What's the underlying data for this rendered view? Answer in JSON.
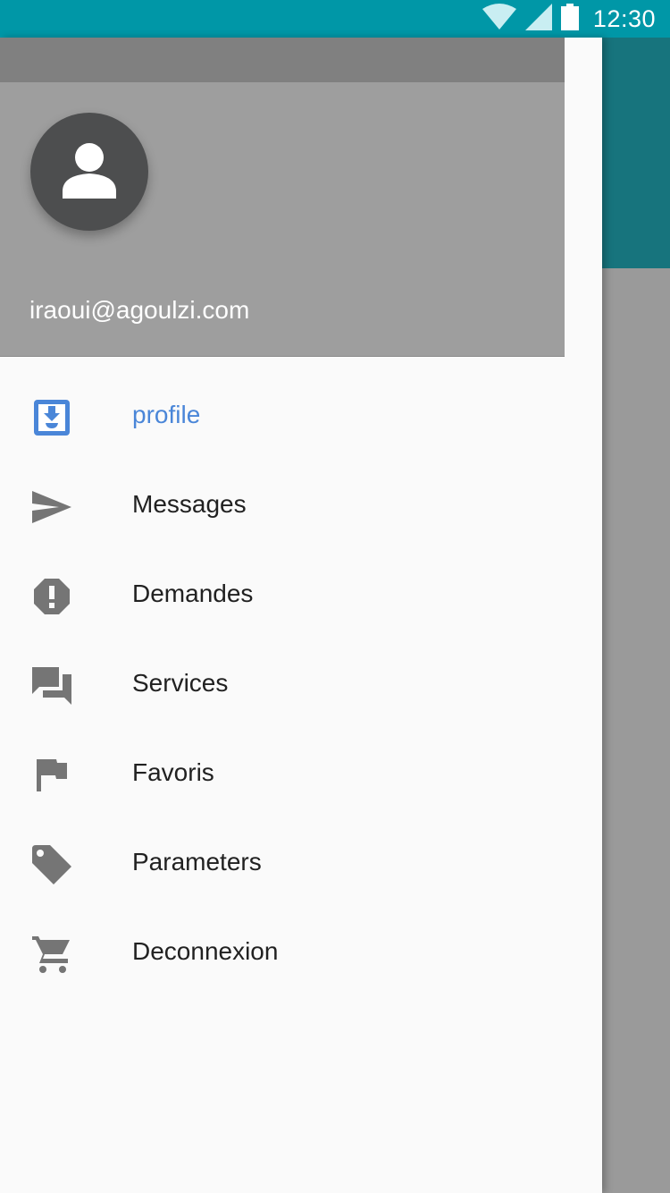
{
  "status_bar": {
    "time": "12:30",
    "icons": [
      "wifi-icon",
      "cell-signal-icon",
      "battery-icon"
    ],
    "background": "#0097a7"
  },
  "drawer": {
    "header": {
      "avatar_icon": "person-icon",
      "email": "iraoui@agoulzi.com"
    },
    "menu": [
      {
        "label": "profile",
        "icon": "move-to-inbox-icon",
        "active": true
      },
      {
        "label": "Messages",
        "icon": "send-icon",
        "active": false
      },
      {
        "label": "Demandes",
        "icon": "report-icon",
        "active": false
      },
      {
        "label": "Services",
        "icon": "forum-icon",
        "active": false
      },
      {
        "label": "Favoris",
        "icon": "flag-icon",
        "active": false
      },
      {
        "label": "Parameters",
        "icon": "label-tag-icon",
        "active": false
      },
      {
        "label": "Deconnexion",
        "icon": "shopping-cart-icon",
        "active": false
      }
    ]
  },
  "colors": {
    "accent": "#4a86d8",
    "icon": "#757575",
    "app_bar": "#17747d",
    "header": "#9e9e9e"
  }
}
